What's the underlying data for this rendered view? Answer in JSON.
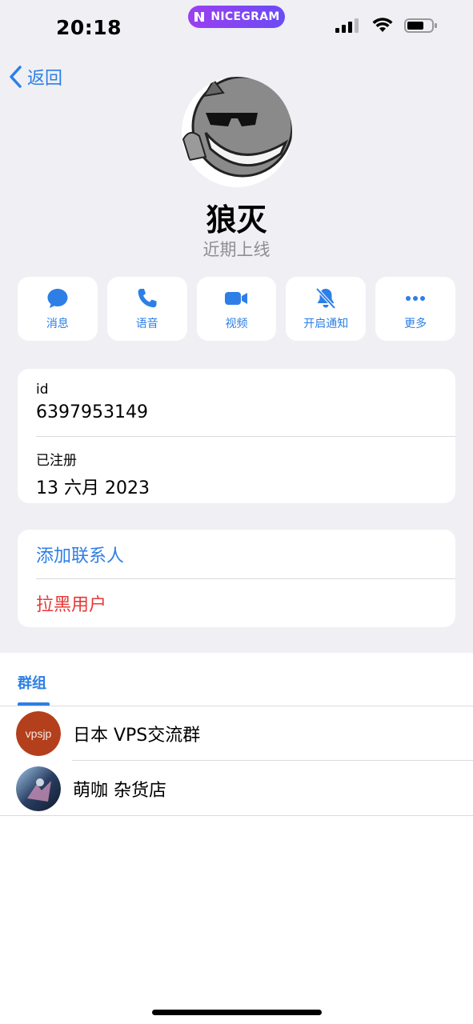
{
  "status_bar": {
    "time": "20:18",
    "app_badge": "NICEGRAM"
  },
  "nav": {
    "back_label": "返回"
  },
  "profile": {
    "name": "狼灭",
    "last_seen": "近期上线"
  },
  "actions": [
    {
      "icon": "message-icon",
      "label": "消息"
    },
    {
      "icon": "phone-icon",
      "label": "语音"
    },
    {
      "icon": "video-icon",
      "label": "视频"
    },
    {
      "icon": "bell-slash-icon",
      "label": "开启通知"
    },
    {
      "icon": "more-icon",
      "label": "更多"
    }
  ],
  "info": {
    "id_label": "id",
    "id_value": "6397953149",
    "registered_label": "已注册",
    "registered_value": "13 六月 2023"
  },
  "contact_actions": {
    "add_contact": "添加联系人",
    "block_user": "拉黑用户"
  },
  "groups": {
    "tab_label": "群组",
    "items": [
      {
        "name": "日本 VPS交流群",
        "avatar_text": "vpsjp"
      },
      {
        "name": "萌咖 杂货店"
      }
    ]
  },
  "colors": {
    "accent": "#2d7fe6",
    "danger": "#e53935",
    "badge": "#8a45f2"
  }
}
